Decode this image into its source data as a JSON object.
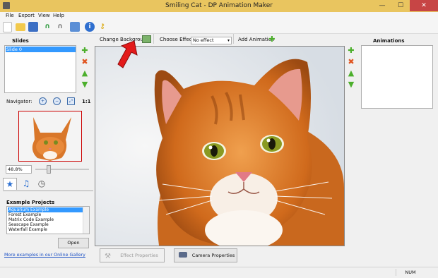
{
  "window": {
    "title": "Smiling Cat - DP Animation Maker",
    "minimize": "—",
    "maximize": "☐",
    "close": "✕"
  },
  "menu": [
    "File",
    "Export",
    "View",
    "Help"
  ],
  "left": {
    "slides_heading": "Slides",
    "slides": [
      "Slide 0"
    ],
    "navigator_label": "Navigator:",
    "zoom_1to1": "1:1",
    "zoom_value": "48.8%",
    "example_projects_heading": "Example Projects",
    "examples": [
      "Aquarium Example",
      "Forest Example",
      "Matrix Code Example",
      "Seascape Example",
      "Waterfall Example"
    ],
    "open_button": "Open",
    "gallery_link": "More examples in our Online Gallery"
  },
  "center": {
    "change_background": "Change Background",
    "choose_effect_label": "Choose Effect:",
    "effect_value": "No effect",
    "add_animation": "Add Animation",
    "effect_properties": "Effect Properties",
    "camera_properties": "Camera Properties"
  },
  "right": {
    "animations_heading": "Animations"
  },
  "status": {
    "num": "NUM"
  },
  "colors": {
    "titlebar": "#e9c55f",
    "selection": "#3399ff",
    "add_green": "#4caf2c",
    "delete_orange": "#e0541f",
    "arrow_red": "#e31a1a"
  }
}
